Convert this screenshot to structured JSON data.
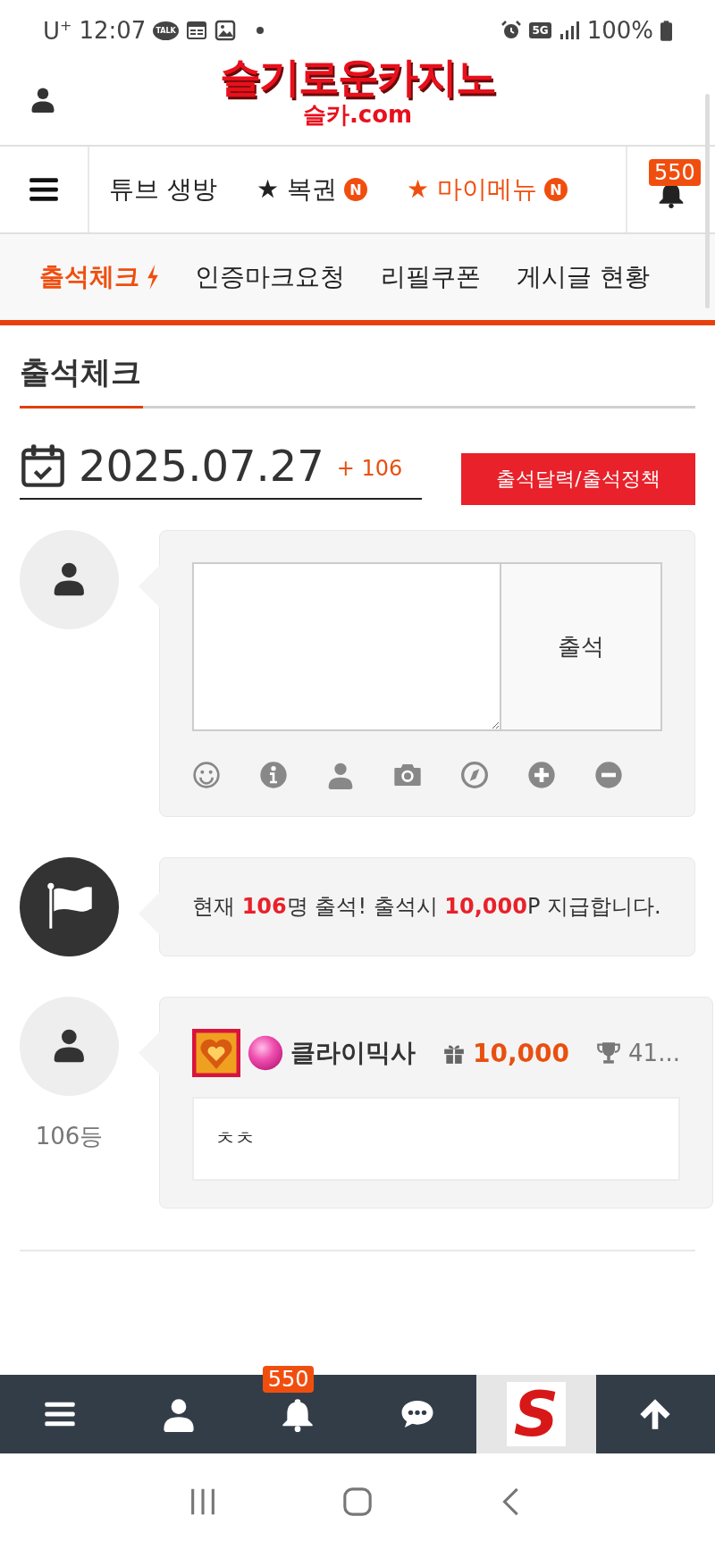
{
  "status_bar": {
    "carrier": "U$^{+}$",
    "time": "12:07",
    "talk_label": "TALK",
    "network": "5G",
    "battery": "100%"
  },
  "header": {
    "logo_title": "슬기로운카지노",
    "logo_domain": "슬카.com"
  },
  "nav": {
    "items": [
      {
        "label": "튜브 생방",
        "color": "#222222"
      },
      {
        "label": "★ 복권",
        "color": "#222222",
        "badge": "N"
      },
      {
        "label": "★ 마이메뉴",
        "color": "#f04e0f",
        "badge": "N"
      }
    ],
    "notification_count": "550"
  },
  "tabs": [
    {
      "label": "출석체크",
      "selected": true
    },
    {
      "label": "인증마크요청",
      "selected": false
    },
    {
      "label": "리필쿠폰",
      "selected": false
    },
    {
      "label": "게시글 현황",
      "selected": false
    }
  ],
  "page_title": "출석체크",
  "date": {
    "value": "2025.07.27",
    "count": "+ 106"
  },
  "calendar_button": "출석달력/출석정책",
  "entries": [
    {
      "kind": "form",
      "submit": "출석"
    },
    {
      "kind": "notice",
      "text": "현재 **106**명 출석! 출석시 **10,000**P 지급합니다."
    },
    {
      "kind": "comment",
      "name": "클라이믹사",
      "points": "10,000",
      "trophy": "41...",
      "body": "ㅊㅊ",
      "rank": "106등"
    }
  ],
  "bottom_bar": {
    "notification_count": "550",
    "logo": "S"
  }
}
